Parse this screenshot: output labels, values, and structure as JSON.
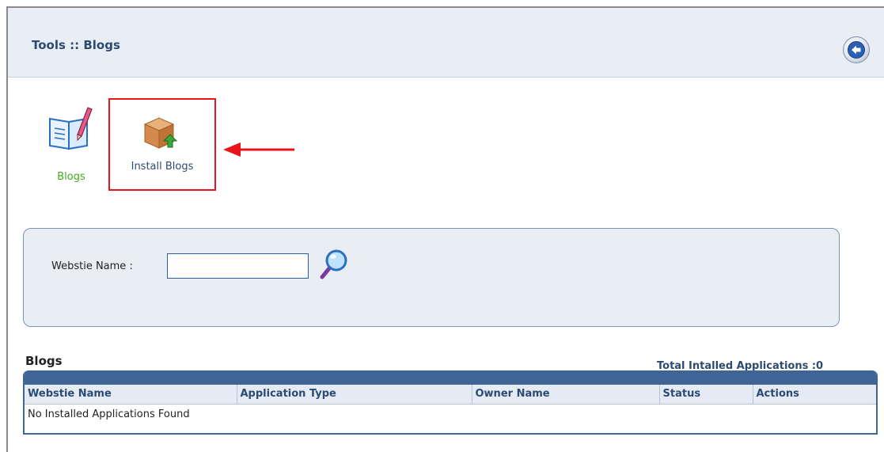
{
  "header": {
    "title": "Tools :: Blogs"
  },
  "tools": [
    {
      "label": "Blogs",
      "icon": "blog-book-icon"
    },
    {
      "label": "Install Blogs",
      "icon": "install-package-icon"
    }
  ],
  "search": {
    "label": "Webstie Name :",
    "value": "",
    "button_icon": "search-icon"
  },
  "grid": {
    "title": "Blogs",
    "total": "Total Intalled Applications :0",
    "columns": [
      "Webstie Name",
      "Application Type",
      "Owner Name",
      "Status",
      "Actions"
    ],
    "empty_message": "No Installed Applications Found"
  },
  "colors": {
    "accent": "#3f6596",
    "highlight": "#e8141b",
    "link_green": "#3faa1c"
  }
}
